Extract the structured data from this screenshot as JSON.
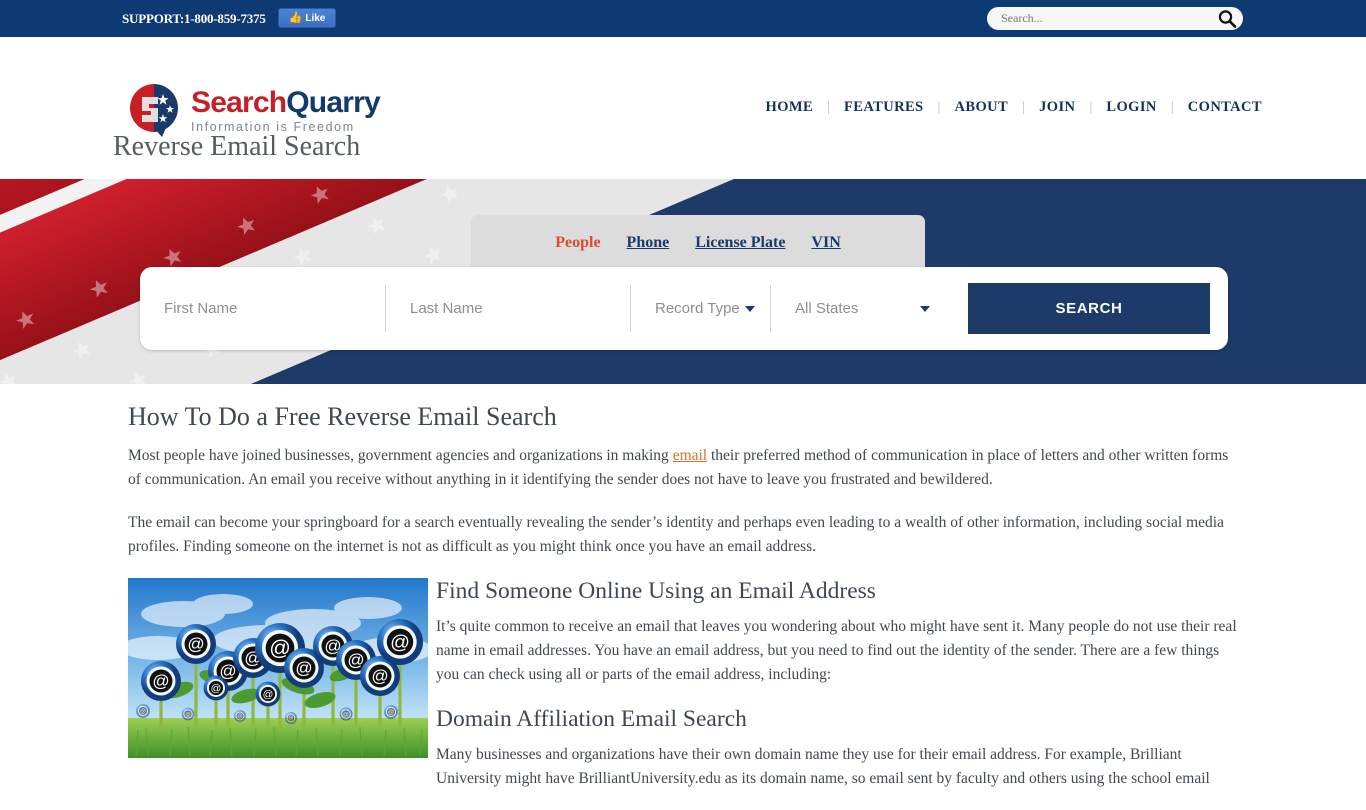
{
  "topbar": {
    "support": "SUPPORT:1-800-859-7375",
    "like_label": "Like",
    "like_icon": "thumbs-up-icon",
    "search_placeholder": "Search...",
    "search_value": "",
    "search_icon": "magnifier-icon",
    "bg_color": "#0e3a73"
  },
  "header": {
    "logo_name": "SearchQuarry",
    "logo_part1": "Search",
    "logo_part2": "Quarry",
    "logo_tagline": "Information is Freedom",
    "logo_red": "#c62026",
    "logo_blue": "#123a6b",
    "nav": [
      {
        "label": "HOME"
      },
      {
        "label": "FEATURES"
      },
      {
        "label": "ABOUT"
      },
      {
        "label": "JOIN"
      },
      {
        "label": "LOGIN"
      },
      {
        "label": "CONTACT"
      }
    ],
    "nav_separator": "|"
  },
  "page_title": "Reverse Email Search",
  "hero": {
    "bg_color": "#1e3a68",
    "tabs": [
      {
        "label": "People",
        "active": true
      },
      {
        "label": "Phone",
        "active": false
      },
      {
        "label": "License Plate",
        "active": false
      },
      {
        "label": "VIN",
        "active": false
      }
    ],
    "active_tab_color": "#dd4b2a",
    "form": {
      "first_name_placeholder": "First Name",
      "first_name_value": "",
      "last_name_placeholder": "Last Name",
      "last_name_value": "",
      "record_type_label": "Record Type",
      "state_label": "All States",
      "search_button": "SEARCH",
      "button_color": "#1e3a68"
    }
  },
  "main": {
    "heading": "How To Do a Free Reverse Email Search",
    "para1_before": "Most people have joined businesses, government agencies and organizations in making ",
    "para1_link": "email",
    "para1_after": " their preferred method of communication in place of letters and other written forms of communication. An email you receive without anything in it identifying the sender does not have to leave you frustrated and bewildered.",
    "para2": "The email can become your springboard for a search eventually revealing the sender’s identity and perhaps even leading to a wealth of other information, including social media profiles. Finding someone on the internet is not as difficult as you might think once you have an email address.",
    "image_alt": "at-symbol-flowers-image",
    "subheading1": "Find Someone Online Using an Email Address",
    "para3": "It’s quite common to receive an email that leaves you wondering about who might have sent it. Many people do not use their real name in email addresses. You have an email address, but you need to find out the identity of the sender. There are a few things you can check using all or parts of the email address, including:",
    "subheading2": "Domain Affiliation Email Search",
    "para4": "Many businesses and organizations have their own domain name they use for their email address. For example, Brilliant University might have BrilliantUniversity.edu as its domain name, so email sent by faculty and others using the school email"
  }
}
